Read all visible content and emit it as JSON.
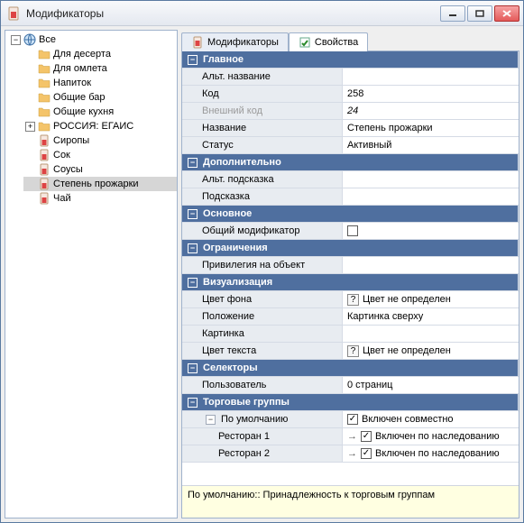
{
  "window": {
    "title": "Модификаторы"
  },
  "tree": {
    "root": "Все",
    "items": [
      "Для десерта",
      "Для омлета",
      "Напиток",
      "Общие бар",
      "Общие кухня",
      "РОССИЯ: ЕГАИС",
      "Сиропы",
      "Сок",
      "Соусы",
      "Степень прожарки",
      "Чай"
    ]
  },
  "tabs": {
    "modifiers": "Модификаторы",
    "properties": "Свойства"
  },
  "sections": {
    "main": "Главное",
    "additional": "Дополнительно",
    "basic": "Основное",
    "constraints": "Ограничения",
    "visual": "Визуализация",
    "selectors": "Селекторы",
    "tradegroups": "Торговые группы"
  },
  "props": {
    "alt_name_label": "Альт. название",
    "alt_name_value": "",
    "code_label": "Код",
    "code_value": "258",
    "ext_code_label": "Внешний код",
    "ext_code_value": "24",
    "name_label": "Название",
    "name_value": "Степень прожарки",
    "status_label": "Статус",
    "status_value": "Активный",
    "alt_tip_label": "Альт. подсказка",
    "alt_tip_value": "",
    "tip_label": "Подсказка",
    "tip_value": "",
    "common_mod_label": "Общий модификатор",
    "privilege_label": "Привилегия на объект",
    "privilege_value": "",
    "bg_label": "Цвет фона",
    "bg_value": "Цвет не определен",
    "pos_label": "Положение",
    "pos_value": "Картинка сверху",
    "pic_label": "Картинка",
    "pic_value": "",
    "fg_label": "Цвет текста",
    "fg_value": "Цвет не определен",
    "user_label": "Пользователь",
    "user_value": "0 страниц",
    "default_label": "По умолчанию",
    "default_value": "Включен совместно",
    "rest1_label": "Ресторан 1",
    "rest1_value": "Включен по наследованию",
    "rest2_label": "Ресторан 2",
    "rest2_value": "Включен по наследованию"
  },
  "hint": "По умолчанию:: Принадлежность к торговым группам"
}
